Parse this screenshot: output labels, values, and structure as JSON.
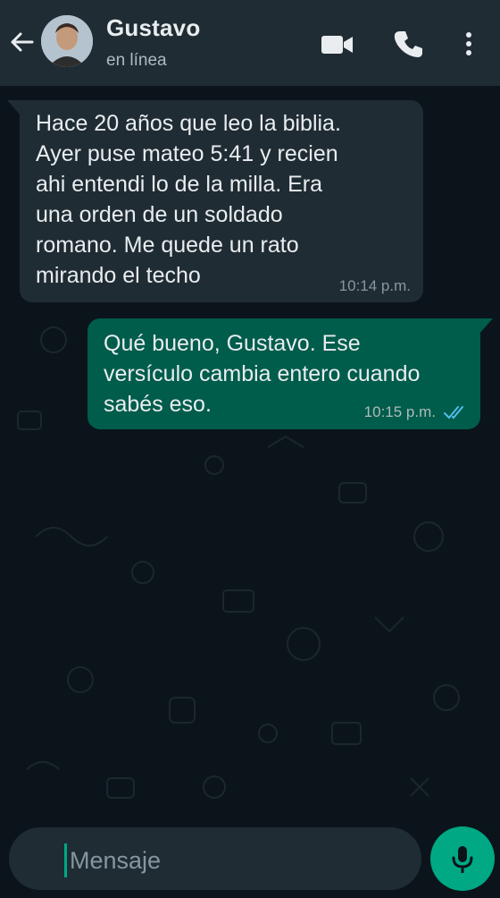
{
  "colors": {
    "background": "#0b141a",
    "header": "#1f2c34",
    "incoming_bubble": "#202c33",
    "outgoing_bubble": "#005c4b",
    "accent": "#00a884",
    "read_ticks": "#53bdeb"
  },
  "header": {
    "back_icon": "arrow-left-icon",
    "contact_name": "Gustavo",
    "status": "en línea",
    "icons": [
      "video-camera-icon",
      "phone-icon",
      "more-vertical-icon"
    ]
  },
  "messages": [
    {
      "direction": "incoming",
      "text": "Hace 20 años que leo la biblia.\nAyer puse mateo 5:41 y recien\nahi entendi lo de la milla. Era\nuna orden de un soldado\nromano. Me quede un rato\nmirando el techo",
      "time": "10:14 p.m."
    },
    {
      "direction": "outgoing",
      "text": "Qué bueno, Gustavo. Ese\nversículo cambia entero cuando\nsabés eso.",
      "time": "10:15 p.m.",
      "status": "read"
    }
  ],
  "composer": {
    "placeholder": "Mensaje",
    "mic_icon": "microphone-icon"
  }
}
